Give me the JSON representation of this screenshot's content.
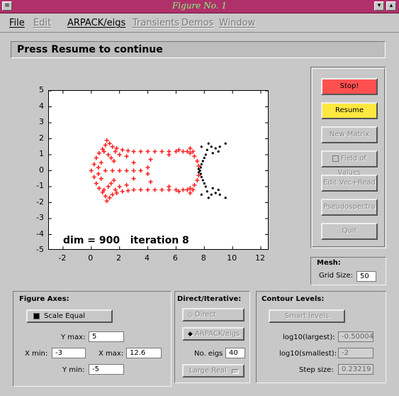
{
  "window": {
    "title": "Figure No. 1"
  },
  "menu": [
    {
      "label": "File",
      "enabled": true
    },
    {
      "label": "Edit",
      "enabled": false
    },
    {
      "label": "ARPACK/eigs",
      "enabled": true
    },
    {
      "label": "Transients",
      "enabled": false
    },
    {
      "label": "Demos",
      "enabled": false
    },
    {
      "label": "Window",
      "enabled": false
    }
  ],
  "status_message": "Press Resume to continue",
  "plot_annotation": {
    "dim_text": "dim = 900",
    "iter_text": "iteration 8"
  },
  "chart_data": {
    "type": "scatter",
    "xlim": [
      -3,
      12.6
    ],
    "ylim": [
      -5,
      5
    ],
    "xticks": [
      -2,
      0,
      2,
      4,
      6,
      8,
      10,
      12
    ],
    "yticks": [
      5,
      4,
      3,
      2,
      1,
      0,
      -1,
      -2,
      -3,
      -4,
      -5
    ],
    "series": [
      {
        "marker": "+",
        "color": "#ff2020",
        "points": [
          [
            0.0,
            0.0
          ],
          [
            0.2,
            0.4
          ],
          [
            0.2,
            -0.4
          ],
          [
            0.35,
            0.8
          ],
          [
            0.35,
            -0.8
          ],
          [
            0.55,
            1.1
          ],
          [
            0.55,
            -1.1
          ],
          [
            0.8,
            1.35
          ],
          [
            0.8,
            -1.35
          ],
          [
            1.0,
            1.6
          ],
          [
            1.0,
            -1.6
          ],
          [
            1.1,
            1.9
          ],
          [
            1.1,
            -1.9
          ],
          [
            1.3,
            1.7
          ],
          [
            1.3,
            -1.7
          ],
          [
            1.5,
            1.5
          ],
          [
            1.5,
            -1.5
          ],
          [
            1.8,
            1.4
          ],
          [
            1.8,
            -1.4
          ],
          [
            2.2,
            1.3
          ],
          [
            2.2,
            -1.3
          ],
          [
            2.6,
            1.25
          ],
          [
            2.6,
            -1.25
          ],
          [
            3.0,
            1.2
          ],
          [
            3.0,
            -1.2
          ],
          [
            3.5,
            1.2
          ],
          [
            3.5,
            -1.2
          ],
          [
            4.0,
            1.2
          ],
          [
            4.0,
            -1.2
          ],
          [
            4.5,
            1.2
          ],
          [
            4.5,
            -1.2
          ],
          [
            5.0,
            1.2
          ],
          [
            5.0,
            -1.2
          ],
          [
            5.5,
            1.2
          ],
          [
            5.5,
            -1.2
          ],
          [
            6.0,
            1.2
          ],
          [
            6.0,
            -1.2
          ],
          [
            6.5,
            1.2
          ],
          [
            6.5,
            -1.2
          ],
          [
            7.0,
            1.1
          ],
          [
            7.0,
            -1.1
          ],
          [
            7.3,
            0.9
          ],
          [
            7.3,
            -0.9
          ],
          [
            7.5,
            0.6
          ],
          [
            7.5,
            -0.6
          ],
          [
            7.6,
            0.3
          ],
          [
            7.6,
            -0.3
          ],
          [
            0.5,
            0.2
          ],
          [
            0.5,
            -0.2
          ],
          [
            0.7,
            0.5
          ],
          [
            0.7,
            -0.5
          ],
          [
            1.0,
            0.0
          ],
          [
            1.5,
            0.0
          ],
          [
            2.0,
            0.0
          ],
          [
            2.5,
            0.0
          ],
          [
            3.0,
            0.0
          ],
          [
            3.5,
            0.0
          ],
          [
            4.0,
            0.2
          ],
          [
            4.0,
            -0.2
          ],
          [
            1.2,
            1.0
          ],
          [
            1.2,
            -1.0
          ],
          [
            1.4,
            0.8
          ],
          [
            1.4,
            -0.8
          ],
          [
            1.6,
            0.6
          ],
          [
            1.6,
            -0.6
          ],
          [
            2.0,
            1.0
          ],
          [
            2.0,
            -1.0
          ],
          [
            2.5,
            0.9
          ],
          [
            2.5,
            -0.9
          ],
          [
            3.0,
            0.5
          ],
          [
            3.0,
            -0.5
          ],
          [
            4.2,
            0.7
          ],
          [
            4.2,
            -0.7
          ],
          [
            5.5,
            1.0
          ],
          [
            5.5,
            -1.0
          ],
          [
            6.2,
            1.3
          ],
          [
            6.2,
            -1.3
          ],
          [
            6.8,
            1.2
          ],
          [
            6.8,
            -1.2
          ],
          [
            7.0,
            1.4
          ],
          [
            7.0,
            -1.4
          ],
          [
            7.2,
            1.2
          ],
          [
            7.2,
            -1.2
          ],
          [
            0.9,
            1.2
          ],
          [
            0.9,
            -1.2
          ],
          [
            1.7,
            1.2
          ],
          [
            1.7,
            -1.2
          ]
        ]
      },
      {
        "marker": ".",
        "color": "#000000",
        "points": [
          [
            7.7,
            0.0
          ],
          [
            7.75,
            0.2
          ],
          [
            7.75,
            -0.2
          ],
          [
            7.8,
            0.4
          ],
          [
            7.8,
            -0.4
          ],
          [
            7.9,
            0.6
          ],
          [
            7.9,
            -0.6
          ],
          [
            8.0,
            0.8
          ],
          [
            8.0,
            -0.8
          ],
          [
            8.1,
            1.0
          ],
          [
            8.1,
            -1.0
          ],
          [
            8.2,
            1.3
          ],
          [
            8.2,
            -1.3
          ],
          [
            8.5,
            1.5
          ],
          [
            8.5,
            -1.5
          ],
          [
            8.8,
            1.4
          ],
          [
            8.8,
            -1.4
          ],
          [
            9.1,
            1.5
          ],
          [
            9.1,
            -1.5
          ],
          [
            9.5,
            1.7
          ],
          [
            9.5,
            -1.7
          ],
          [
            8.3,
            1.7
          ],
          [
            8.3,
            -1.7
          ],
          [
            7.8,
            1.5
          ],
          [
            7.8,
            -1.5
          ],
          [
            8.6,
            1.1
          ],
          [
            8.6,
            -1.1
          ],
          [
            9.0,
            1.2
          ],
          [
            9.0,
            -1.2
          ],
          [
            7.6,
            0.1
          ],
          [
            7.6,
            -0.1
          ]
        ]
      }
    ]
  },
  "right_buttons": [
    {
      "label": "Stop!",
      "state": "stop"
    },
    {
      "label": "Resume",
      "state": "resume"
    },
    {
      "label": "New Matrix",
      "state": "disabled"
    },
    {
      "label": "Field of Values",
      "state": "disabled"
    },
    {
      "label": "Edit Vec+Read",
      "state": "disabled"
    },
    {
      "label": "Pseudospectra",
      "state": "disabled"
    },
    {
      "label": "Quit",
      "state": "disabled"
    }
  ],
  "mesh": {
    "title": "Mesh:",
    "grid_label": "Grid Size:",
    "grid_value": "50"
  },
  "figure_axes": {
    "title": "Figure Axes:",
    "scale_equal": "Scale Equal",
    "ymax_label": "Y max:",
    "ymax": "5",
    "xmin_label": "X min:",
    "xmin": "-3",
    "xmax_label": "X max:",
    "xmax": "12.6",
    "ymin_label": "Y min:",
    "ymin": "-5"
  },
  "direct_iterative": {
    "title": "Direct/Iterative:",
    "direct": "Direct",
    "arpack": "ARPACK/eigs",
    "neigs_label": "No. eigs",
    "neigs": "40",
    "mode": "Large Real"
  },
  "contour_levels": {
    "title": "Contour Levels:",
    "smart": "Smart levels",
    "largest_label": "log10(largest):",
    "largest": "-0.50004",
    "smallest_label": "log10(smallest):",
    "smallest": "-2",
    "step_label": "Step size:",
    "step": "0.23219"
  },
  "colors": {
    "stop": "#ff5050",
    "resume": "#ffe840",
    "title_bar": "#b0306a"
  }
}
